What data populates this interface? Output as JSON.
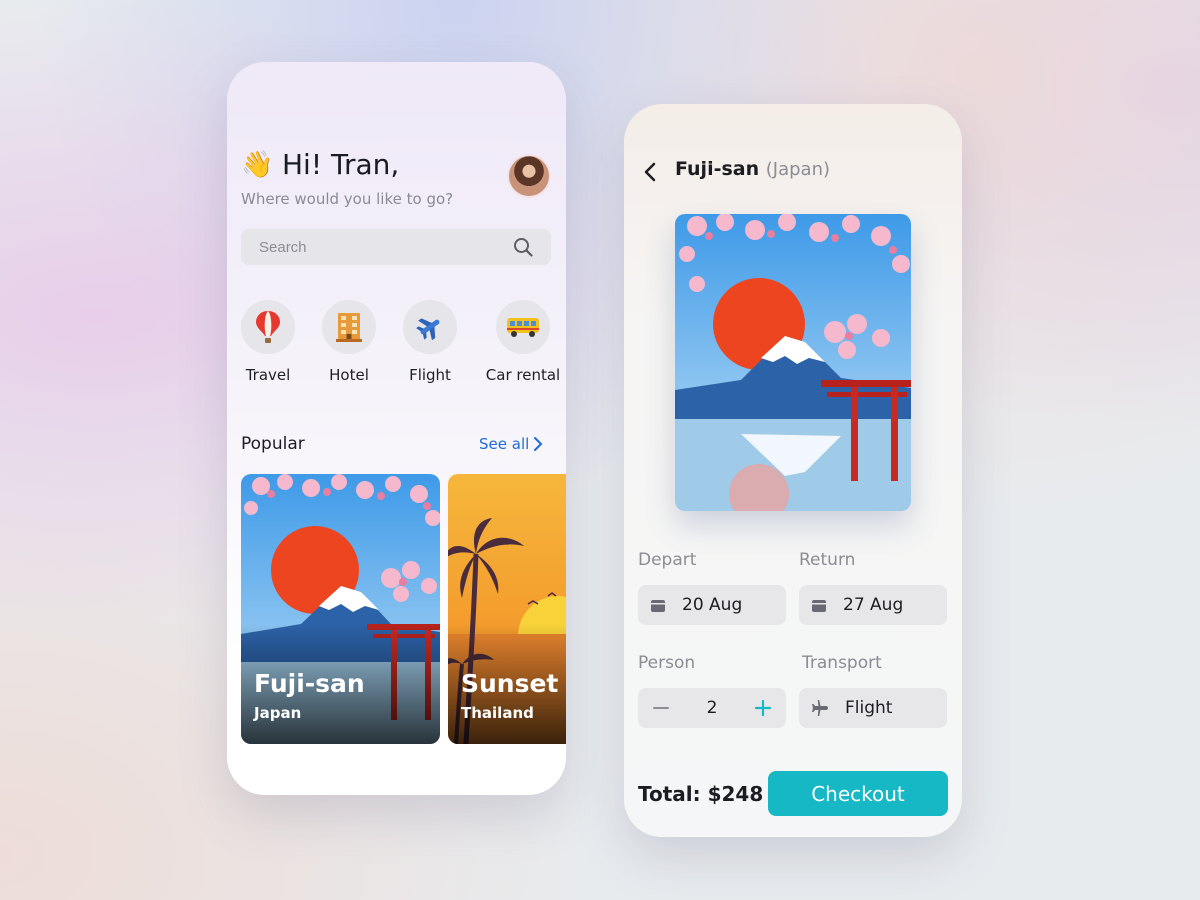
{
  "home": {
    "greeting": "Hi! Tran,",
    "subtitle": "Where would you like to go?",
    "search_placeholder": "Search",
    "categories": [
      {
        "label": "Travel",
        "icon": "hot-air-balloon-icon"
      },
      {
        "label": "Hotel",
        "icon": "hotel-building-icon"
      },
      {
        "label": "Flight",
        "icon": "airplane-icon"
      },
      {
        "label": "Car rental",
        "icon": "bus-icon"
      }
    ],
    "popular_title": "Popular",
    "see_all": "See all",
    "destinations": [
      {
        "name": "Fuji-san",
        "country": "Japan"
      },
      {
        "name": "Sunset Beach",
        "country": "Thailand"
      }
    ]
  },
  "detail": {
    "title": "Fuji-san",
    "title_sub": "(Japan)",
    "depart_label": "Depart",
    "depart_value": "20 Aug",
    "return_label": "Return",
    "return_value": "27 Aug",
    "person_label": "Person",
    "person_value": "2",
    "transport_label": "Transport",
    "transport_value": "Flight",
    "total": "Total: $248",
    "checkout_label": "Checkout"
  },
  "colors": {
    "accent": "#15b8c4",
    "link": "#1e6bd8",
    "field_bg": "#e7e7ea"
  }
}
